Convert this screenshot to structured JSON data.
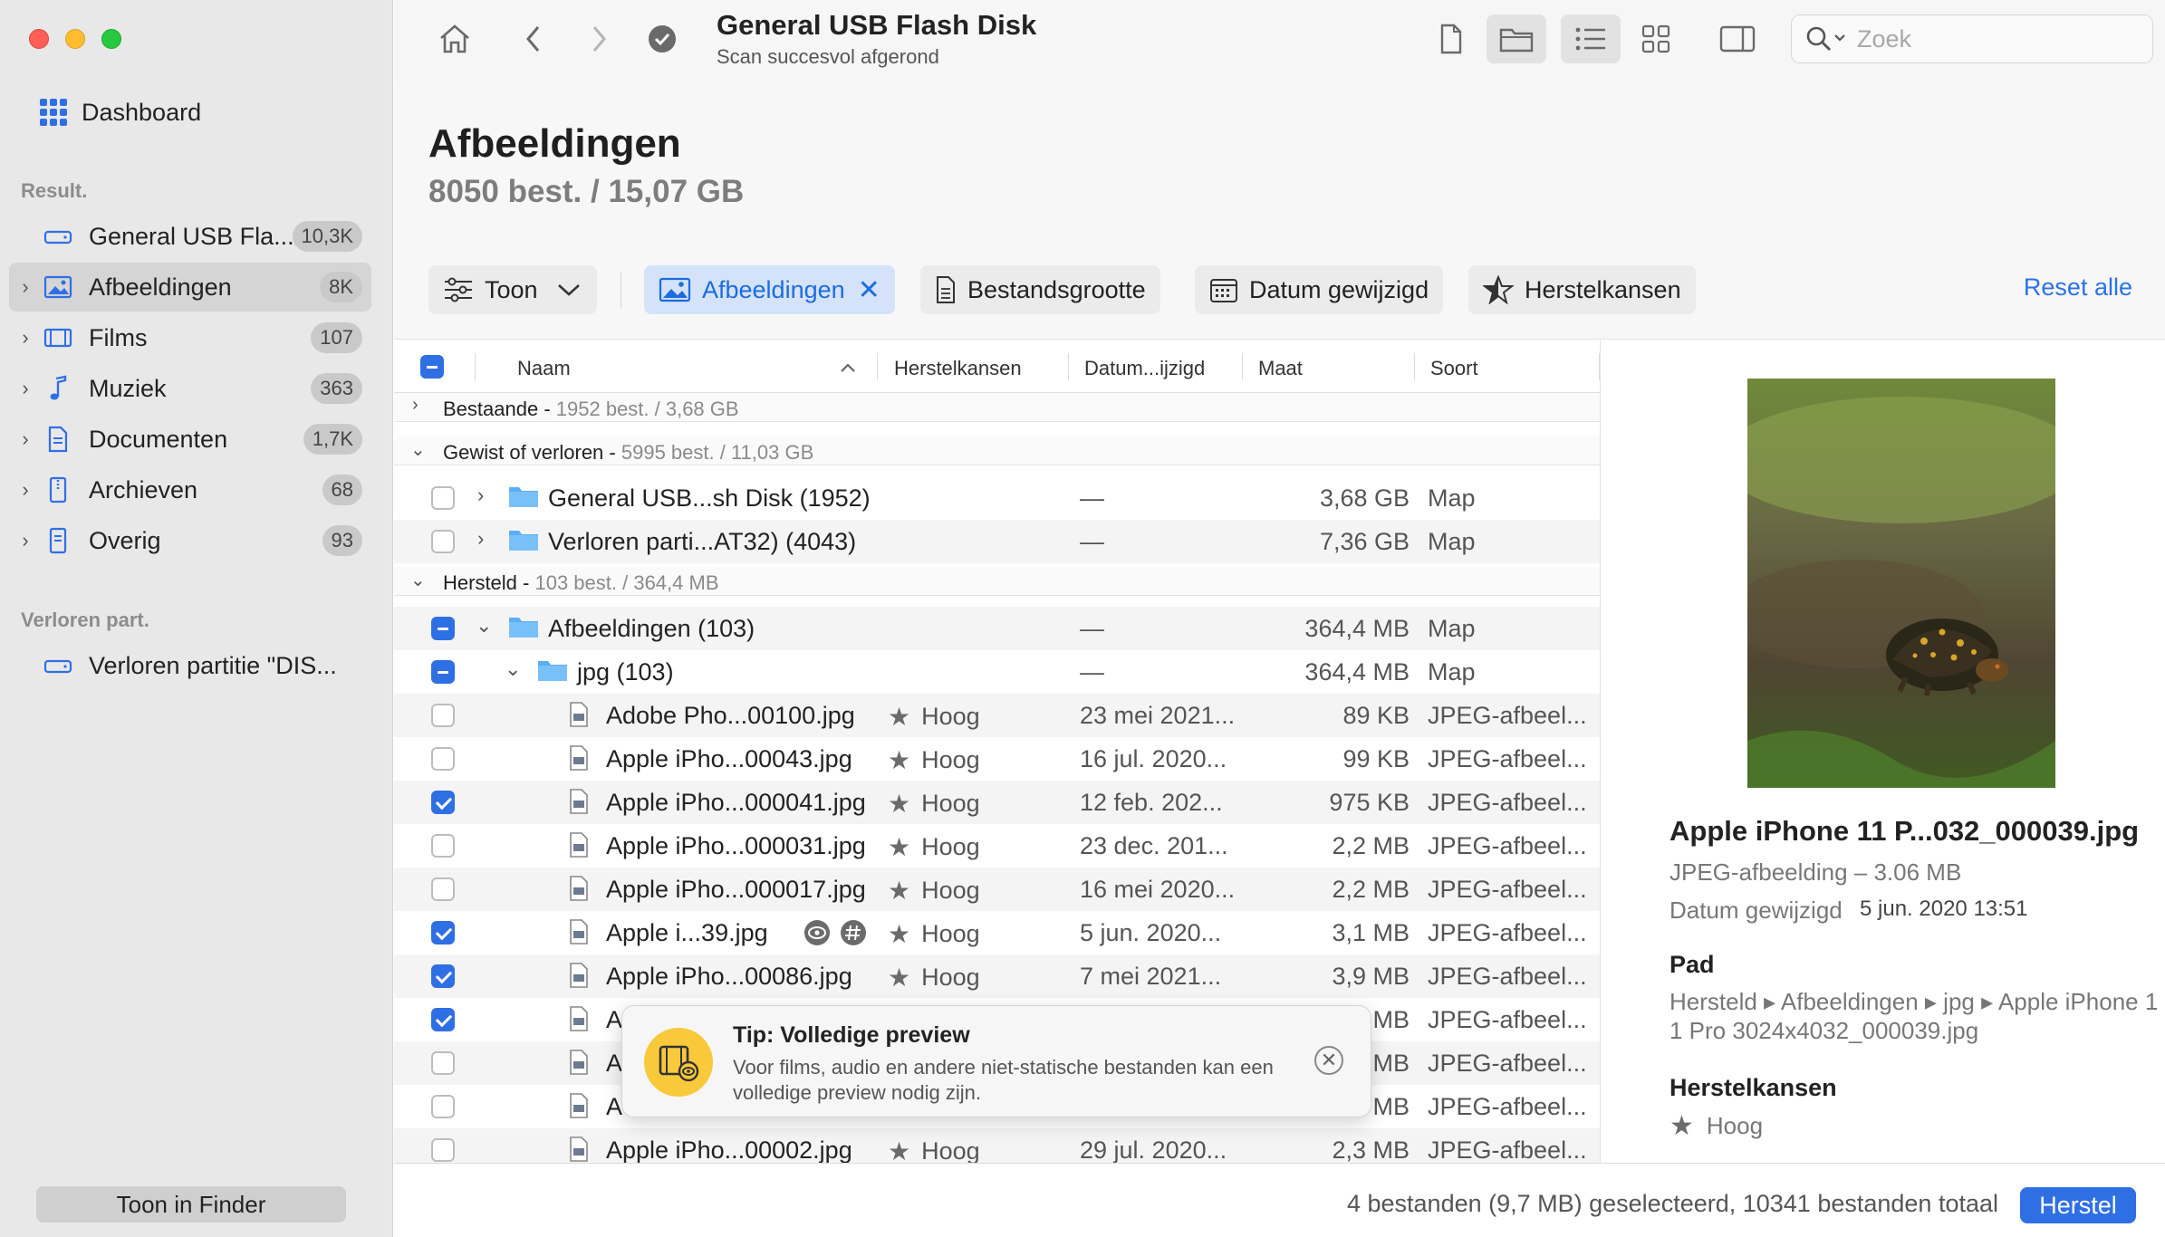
{
  "sidebar": {
    "dashboard": "Dashboard",
    "section_results": "Result.",
    "items": [
      {
        "label": "General USB Fla...",
        "count": "10,3K"
      },
      {
        "label": "Afbeeldingen",
        "count": "8K"
      },
      {
        "label": "Films",
        "count": "107"
      },
      {
        "label": "Muziek",
        "count": "363"
      },
      {
        "label": "Documenten",
        "count": "1,7K"
      },
      {
        "label": "Archieven",
        "count": "68"
      },
      {
        "label": "Overig",
        "count": "93"
      }
    ],
    "section_lost": "Verloren part.",
    "lost_item": "Verloren partitie \"DIS...",
    "finder_button": "Toon in Finder"
  },
  "toolbar": {
    "title": "General USB Flash Disk",
    "subtitle": "Scan succesvol afgerond",
    "search_placeholder": "Zoek"
  },
  "header": {
    "title": "Afbeeldingen",
    "subtitle": "8050 best. / 15,07 GB",
    "filters": {
      "show": "Toon",
      "images": "Afbeeldingen",
      "size": "Bestandsgrootte",
      "date": "Datum gewijzigd",
      "recovery": "Herstelkansen"
    },
    "reset": "Reset alle"
  },
  "table": {
    "columns": {
      "name": "Naam",
      "recovery": "Herstelkansen",
      "date": "Datum...ijzigd",
      "size": "Maat",
      "kind": "Soort"
    },
    "groups": {
      "existing": {
        "label": "Bestaande",
        "info": "1952 best. / 3,68 GB"
      },
      "deleted": {
        "label": "Gewist of verloren",
        "info": "5995 best. / 11,03 GB"
      },
      "recovered": {
        "label": "Hersteld",
        "info": "103 best. / 364,4 MB"
      }
    },
    "rows": [
      {
        "name": "General USB...sh Disk (1952)",
        "date": "—",
        "size": "3,68 GB",
        "kind": "Map"
      },
      {
        "name": "Verloren parti...AT32) (4043)",
        "date": "—",
        "size": "7,36 GB",
        "kind": "Map"
      },
      {
        "name": "Afbeeldingen (103)",
        "date": "—",
        "size": "364,4 MB",
        "kind": "Map"
      },
      {
        "name": "jpg (103)",
        "date": "—",
        "size": "364,4 MB",
        "kind": "Map"
      },
      {
        "name": "Adobe Pho...00100.jpg",
        "recovery": "Hoog",
        "date": "23 mei 2021...",
        "size": "89 KB",
        "kind": "JPEG-afbeel..."
      },
      {
        "name": "Apple iPho...00043.jpg",
        "recovery": "Hoog",
        "date": "16 jul. 2020...",
        "size": "99 KB",
        "kind": "JPEG-afbeel..."
      },
      {
        "name": "Apple iPho...000041.jpg",
        "recovery": "Hoog",
        "date": "12 feb. 202...",
        "size": "975 KB",
        "kind": "JPEG-afbeel..."
      },
      {
        "name": "Apple iPho...000031.jpg",
        "recovery": "Hoog",
        "date": "23 dec. 201...",
        "size": "2,2 MB",
        "kind": "JPEG-afbeel..."
      },
      {
        "name": "Apple iPho...000017.jpg",
        "recovery": "Hoog",
        "date": "16 mei 2020...",
        "size": "2,2 MB",
        "kind": "JPEG-afbeel..."
      },
      {
        "name": "Apple i...39.jpg",
        "recovery": "Hoog",
        "date": "5 jun. 2020...",
        "size": "3,1 MB",
        "kind": "JPEG-afbeel..."
      },
      {
        "name": "Apple iPho...00086.jpg",
        "recovery": "Hoog",
        "date": "7 mei 2021...",
        "size": "3,9 MB",
        "kind": "JPEG-afbeel..."
      },
      {
        "name": "A",
        "size": "MB",
        "kind": "JPEG-afbeel..."
      },
      {
        "name": "A",
        "size": "MB",
        "kind": "JPEG-afbeel..."
      },
      {
        "name": "A",
        "size": "MB",
        "kind": "JPEG-afbeel..."
      },
      {
        "name": "Apple iPho...00002.jpg",
        "recovery": "Hoog",
        "date": "29 jul. 2020...",
        "size": "2,3 MB",
        "kind": "JPEG-afbeel..."
      }
    ]
  },
  "tip": {
    "title": "Tip: Volledige preview",
    "body": "Voor films, audio en andere niet-statische bestanden kan een volledige preview nodig zijn."
  },
  "preview": {
    "name": "Apple iPhone 11 P...032_000039.jpg",
    "type": "JPEG-afbeelding – 3.06 MB",
    "date_label": "Datum gewijzigd",
    "date_value": "5 jun. 2020 13:51",
    "path_heading": "Pad",
    "path": "Hersteld ▸ Afbeeldingen ▸ jpg ▸ Apple iPhone 11 Pro 3024x4032_000039.jpg",
    "recovery_heading": "Herstelkansen",
    "recovery_value": "Hoog"
  },
  "status": {
    "text": "4 bestanden (9,7 MB) geselecteerd, 10341 bestanden totaal",
    "recover_button": "Herstel"
  },
  "colors": {
    "accent": "#2f6fe4",
    "sidebar_bg": "#e9e8e8",
    "tip_icon_bg": "#f8c93b"
  }
}
